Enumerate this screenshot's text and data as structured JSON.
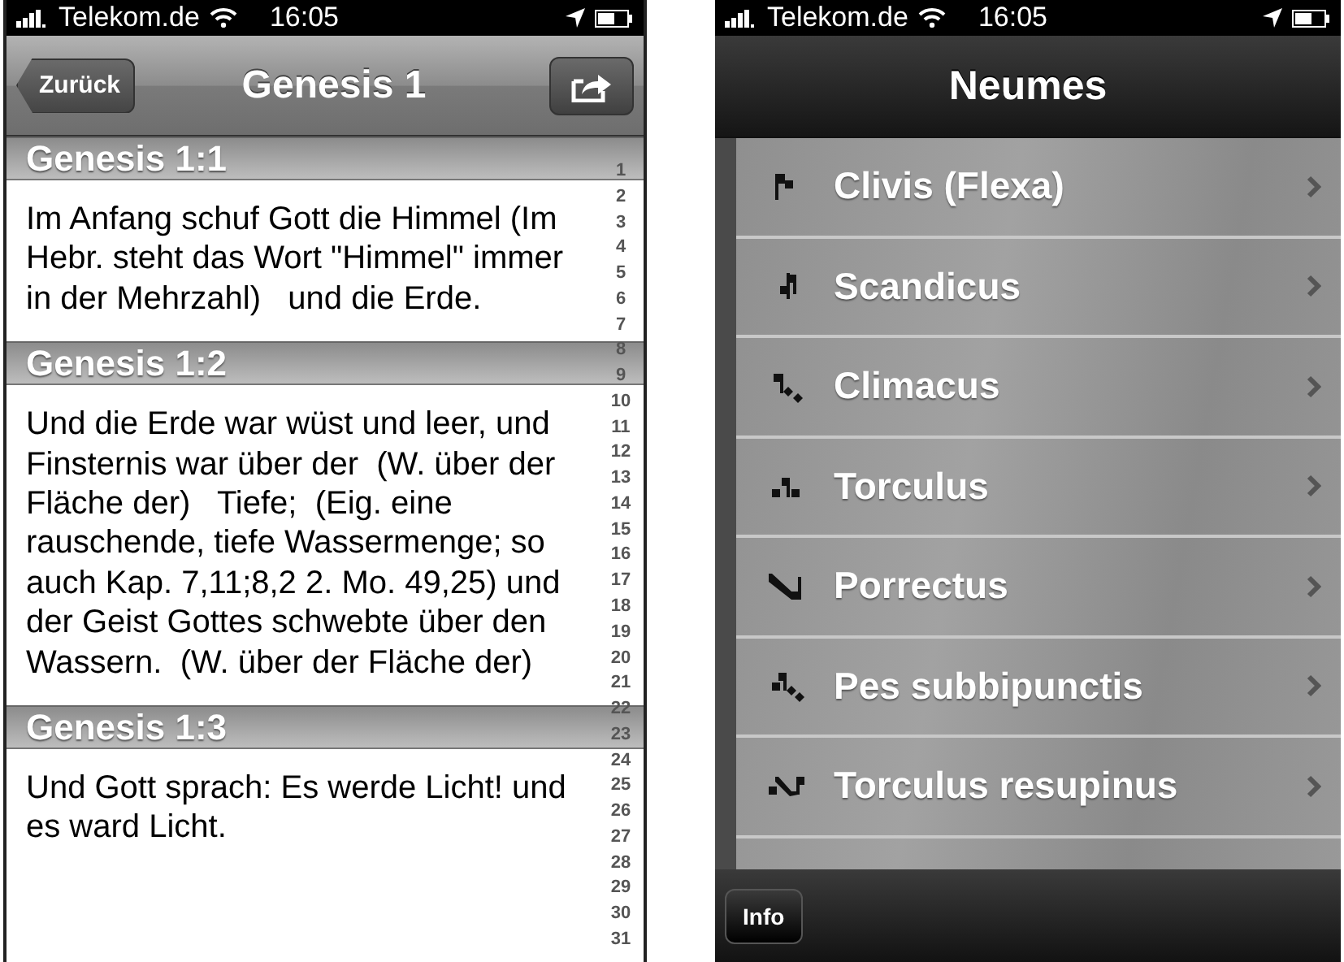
{
  "reader_screen": {
    "status_bar": {
      "carrier": "Telekom.de",
      "time": "16:05"
    },
    "nav_bar": {
      "back_button": "Zurück",
      "title": "Genesis 1"
    },
    "verses": [
      {
        "heading": "Genesis 1:1",
        "text": "Im Anfang schuf Gott die Himmel (Im Hebr. steht das Wort \"Himmel\" immer in der Mehrzahl)   und die Erde."
      },
      {
        "heading": "Genesis 1:2",
        "text": "Und die Erde war wüst und leer, und Finsternis war über der  (W. über der Fläche der)   Tiefe;  (Eig. eine rauschende, tiefe Wassermenge; so auch Kap. 7,11;8,2 2. Mo. 49,25) und der Geist Gottes schwebte über den Wassern.  (W. über der Fläche der)"
      },
      {
        "heading": "Genesis 1:3",
        "text": "Und Gott sprach: Es werde Licht! und es ward Licht."
      }
    ],
    "index": [
      "1",
      "2",
      "3",
      "4",
      "5",
      "6",
      "7",
      "8",
      "9",
      "10",
      "11",
      "12",
      "13",
      "14",
      "15",
      "16",
      "17",
      "18",
      "19",
      "20",
      "21",
      "22",
      "23",
      "24",
      "25",
      "26",
      "27",
      "28",
      "29",
      "30",
      "31"
    ]
  },
  "neumes_screen": {
    "status_bar": {
      "carrier": "Telekom.de",
      "time": "16:05"
    },
    "nav_bar": {
      "title": "Neumes"
    },
    "rows": [
      {
        "label": "Clivis (Flexa)"
      },
      {
        "label": "Scandicus"
      },
      {
        "label": "Climacus"
      },
      {
        "label": "Torculus"
      },
      {
        "label": "Porrectus"
      },
      {
        "label": "Pes subbipunctis"
      },
      {
        "label": "Torculus resupinus"
      }
    ],
    "toolbar": {
      "info_button": "Info"
    }
  }
}
